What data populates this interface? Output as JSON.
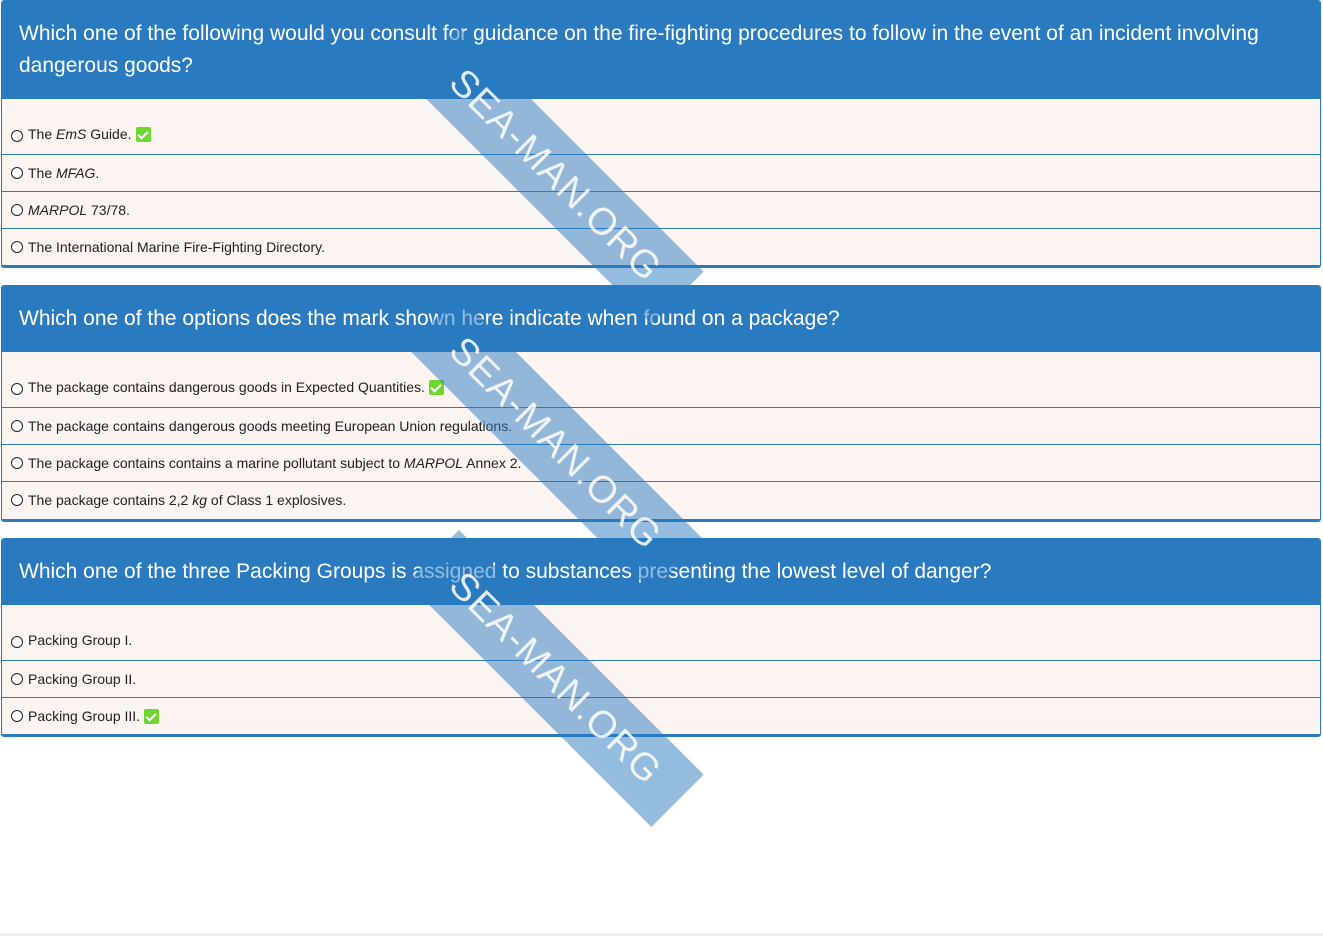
{
  "questions": [
    {
      "question": "Which one of the following would you consult for guidance on the fire-fighting procedures to follow in the event of an incident involving dangerous goods?",
      "options": [
        {
          "pre": "The ",
          "em": "EmS",
          "post": " Guide.",
          "correct": true
        },
        {
          "pre": "The ",
          "em": "MFAG",
          "post": ".",
          "correct": false
        },
        {
          "pre": "",
          "em": "MARPOL",
          "post": " 73/78.",
          "correct": false
        },
        {
          "pre": "The International Marine Fire-Fighting Directory.",
          "em": "",
          "post": "",
          "correct": false
        }
      ]
    },
    {
      "question": "Which one of the options does the mark shown here indicate when found on a package?",
      "options": [
        {
          "pre": "The package contains dangerous goods in Expected Quantities.",
          "em": "",
          "post": "",
          "correct": true
        },
        {
          "pre": "The package contains dangerous goods meeting European Union regulations.",
          "em": "",
          "post": "",
          "correct": false
        },
        {
          "pre": "The package contains contains a marine pollutant subject to ",
          "em": "MARPOL",
          "post": " Annex 2.",
          "correct": false
        },
        {
          "pre": "The package contains 2,2 ",
          "em": "kg",
          "post": " of Class 1 explosives.",
          "correct": false
        }
      ]
    },
    {
      "question": "Which one of the three Packing Groups is assigned to substances presenting the lowest level of danger?",
      "options": [
        {
          "pre": "Packing Group I.",
          "em": "",
          "post": "",
          "correct": false
        },
        {
          "pre": "Packing Group II.",
          "em": "",
          "post": "",
          "correct": false
        },
        {
          "pre": "Packing Group III.",
          "em": "",
          "post": "",
          "correct": true
        }
      ]
    }
  ],
  "watermark": "SEA-MAN.ORG",
  "colors": {
    "header": "#2a7abf",
    "option_bg": "#fcf4f0",
    "correct_badge": "#6fd62b"
  }
}
